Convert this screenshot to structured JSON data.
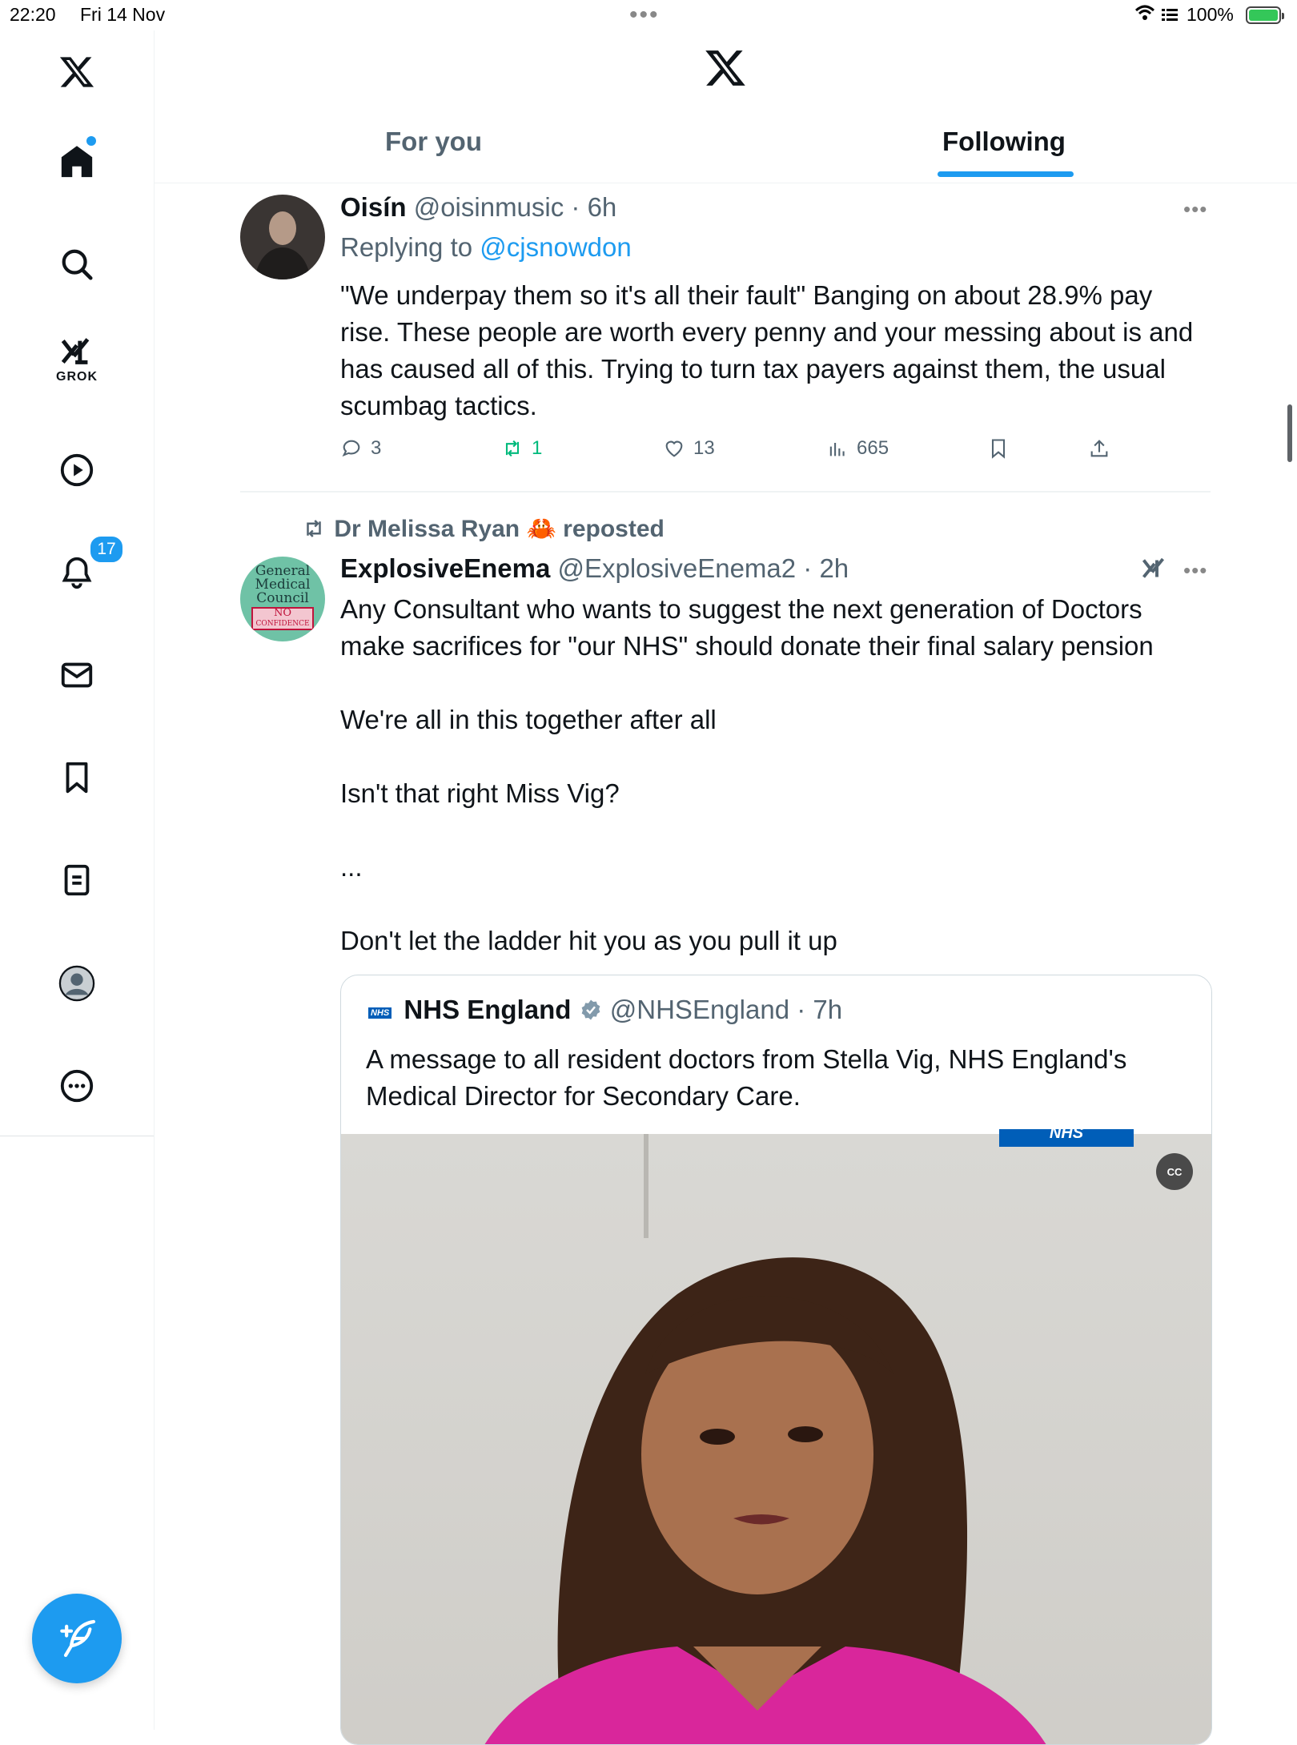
{
  "status_bar": {
    "time": "22:20",
    "date": "Fri 14 Nov",
    "battery": "100%"
  },
  "sidebar": {
    "grok_label": "GROK",
    "notifications_badge": "17",
    "accent": "#1d9bf0"
  },
  "header": {
    "tabs": [
      {
        "label": "For you",
        "active": false
      },
      {
        "label": "Following",
        "active": true
      }
    ]
  },
  "tweets": [
    {
      "name": "Oisín",
      "handle": "@oisinmusic",
      "time": "6h",
      "replying_prefix": "Replying to",
      "replying_handle": "@cjsnowdon",
      "text": "\"We underpay them so it's all their fault\" Banging on about 28.9% pay rise. These people are worth every penny and your messing about is and has caused all of this. Trying to turn tax payers against them, the usual scumbag tactics.",
      "replies": "3",
      "reposts": "1",
      "likes": "13",
      "views": "665"
    },
    {
      "repost_by": "Dr Melissa Ryan 🦀",
      "repost_suffix": "reposted",
      "name": "ExplosiveEnema",
      "handle": "@ExplosiveEnema2",
      "time": "2h",
      "avatar_text": [
        "General",
        "Medical",
        "Council",
        "NO",
        "CONFIDENCE"
      ],
      "paragraphs": [
        "Any Consultant who wants to suggest the next generation of Doctors make sacrifices for \"our NHS\" should donate their final salary pension",
        "We're all in this together after all",
        "Isn't that right Miss Vig?",
        "...",
        "Don't let the ladder hit you as you pull it up"
      ],
      "quote": {
        "logo_text": "NHS",
        "name": "NHS England",
        "handle": "@NHSEngland",
        "time": "7h",
        "text": "A message to all resident doctors from Stella Vig, NHS England's Medical Director for Secondary Care.",
        "cc_label": "CC",
        "video_logo": "NHS"
      }
    }
  ]
}
